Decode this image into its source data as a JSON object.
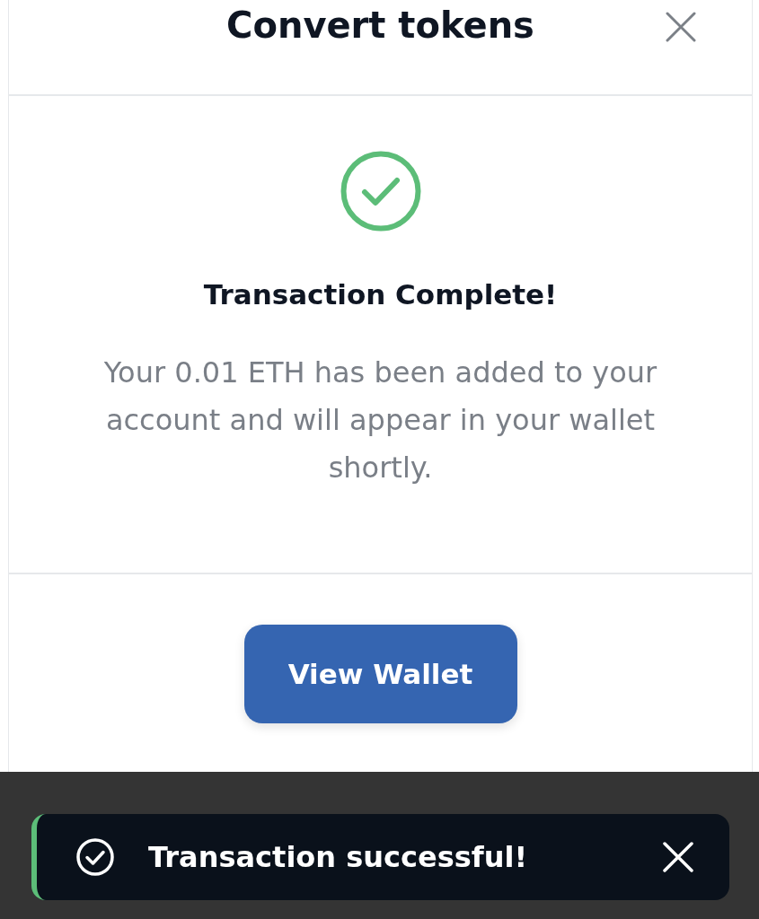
{
  "dialog": {
    "title": "Convert tokens"
  },
  "result": {
    "title": "Transaction Complete!",
    "message": "Your 0.01 ETH has been added to your account and will appear in your wallet shortly."
  },
  "actions": [
    {
      "label": "View Wallet",
      "kind": "primary"
    }
  ],
  "toast": {
    "kind": "success",
    "message": "Transaction successful!"
  }
}
